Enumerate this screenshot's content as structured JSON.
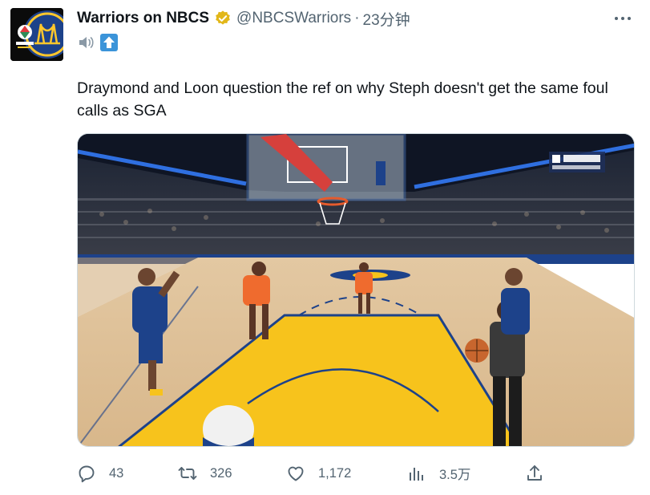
{
  "tweet": {
    "author": {
      "display_name": "Warriors on NBCS",
      "handle": "@NBCSWarriors",
      "verified_color": "#e2b719",
      "avatar_icon": "nbc-sports-warriors-logo",
      "bio_icons": [
        "speaker-emoji",
        "up-arrow-emoji"
      ]
    },
    "separator": "·",
    "timestamp": "23分钟",
    "text": "Draymond and Loon question the ref on why Steph doesn't get the same foul calls as SGA",
    "media": {
      "type": "video-still",
      "scoreboard_bug": "NBC Sports AUTHENTIC",
      "court_colors": {
        "lane": "#f7c31c",
        "floor": "#d9b88c",
        "lines": "#1d428a"
      }
    },
    "actions": {
      "reply": {
        "icon": "reply-icon",
        "count": "43"
      },
      "retweet": {
        "icon": "retweet-icon",
        "count": "326"
      },
      "like": {
        "icon": "heart-icon",
        "count": "1,172"
      },
      "views": {
        "icon": "views-icon",
        "count": "3.5万"
      },
      "share": {
        "icon": "share-icon"
      }
    },
    "colors": {
      "text": "#0f1419",
      "muted": "#536471",
      "border": "#cfd9de"
    }
  }
}
